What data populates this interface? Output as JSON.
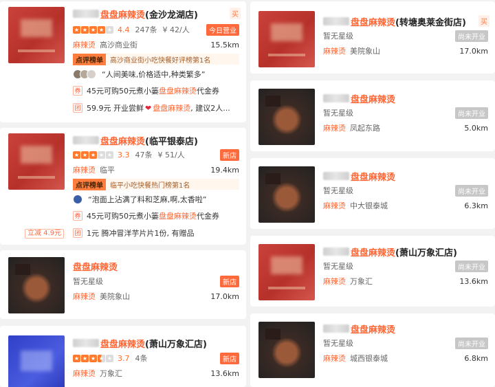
{
  "left": [
    {
      "name_em": "盘盘麻辣烫",
      "name_rest": "(金沙龙湖店)",
      "corner": "买",
      "rating": {
        "stars": 4,
        "score": "4.4",
        "count": "247条",
        "price": "¥ 42/人"
      },
      "badge": "今日营业",
      "category": "麻辣烫",
      "area": "高沙商业街",
      "distance": "15.5km",
      "rank_tag": "点评榜单",
      "rank_text": "高沙商业街小吃快餐好评榜第1名",
      "quote": "“人间美味,价格适中,种类繁多”",
      "deal1_tag": "券",
      "deal1_pre": "45元可购50元煮小篓",
      "deal1_em": "盘盘麻辣烫",
      "deal1_post": "代金券",
      "deal2_tag": "团",
      "deal2_pre": "59.9元 开业尝鲜",
      "deal2_em": "盘盘麻辣烫",
      "deal2_post": ", 建议2人..."
    },
    {
      "name_em": "盘盘麻辣烫",
      "name_rest": "(临平银泰店)",
      "rating": {
        "stars": 3,
        "score": "3.3",
        "count": "47条",
        "price": "¥ 51/人"
      },
      "badge": "新店",
      "category": "麻辣烫",
      "area": "临平",
      "distance": "19.4km",
      "rank_tag": "点评榜单",
      "rank_text": "临平小吃快餐热门榜第1名",
      "quote": "“泡面上沾满了料和芝麻,啊,太香啦”",
      "deal1_tag": "券",
      "deal1_pre": "45元可购50元煮小篓",
      "deal1_em": "盘盘麻辣烫",
      "deal1_post": "代金券",
      "promo": "立减 4.9元",
      "deal2_tag": "团",
      "deal2_text": "1元 腾冲冒洋芋片片1份, 有赠品"
    },
    {
      "name_em": "盘盘麻辣烫",
      "name_rest": "",
      "nostar": "暂无星级",
      "badge": "新店",
      "category": "麻辣烫",
      "area": "美院象山",
      "distance": "17.0km"
    },
    {
      "name_em": "盘盘麻辣烫",
      "name_rest": "(萧山万象汇店)",
      "rating": {
        "stars": 3.5,
        "score": "3.7",
        "count": "4条"
      },
      "badge": "新店",
      "category": "麻辣烫",
      "area": "万象汇",
      "distance": "13.6km"
    }
  ],
  "right": [
    {
      "name_em": "盘盘麻辣烫",
      "name_rest": "(转塘奥莱金街店)",
      "corner": "买",
      "nostar": "暂无星级",
      "badge": "尚未开业",
      "category": "麻辣烫",
      "area": "美院象山",
      "distance": "17.0km"
    },
    {
      "name_em": "盘盘麻辣烫",
      "name_rest": "",
      "nostar": "暂无星级",
      "badge": "尚未开业",
      "category": "麻辣烫",
      "area": "凤起东路",
      "distance": "5.0km"
    },
    {
      "name_em": "盘盘麻辣烫",
      "name_rest": "",
      "nostar": "暂无星级",
      "badge": "尚未开业",
      "category": "麻辣烫",
      "area": "中大银泰城",
      "distance": "6.3km"
    },
    {
      "name_em": "盘盘麻辣烫",
      "name_rest": "(萧山万象汇店)",
      "nostar": "暂无星级",
      "badge": "尚未开业",
      "category": "麻辣烫",
      "area": "万象汇",
      "distance": "13.6km"
    },
    {
      "name_em": "盘盘麻辣烫",
      "name_rest": "",
      "nostar": "暂无星级",
      "badge": "尚未开业",
      "category": "麻辣烫",
      "area": "城西银泰城",
      "distance": "6.8km"
    }
  ],
  "colors": {
    "accent": "#ff6633",
    "badge_open": "#ff6a3d",
    "badge_closed": "#c7c7c7",
    "rank_bg": "#fff6ee"
  }
}
